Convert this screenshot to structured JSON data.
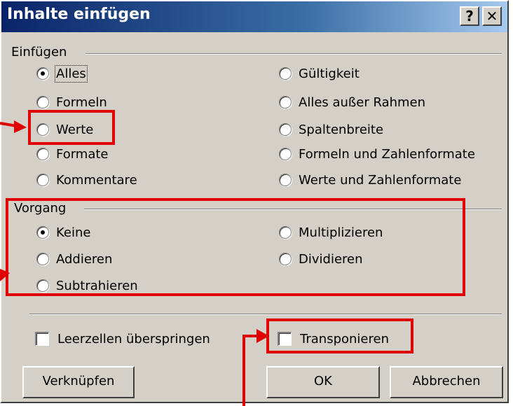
{
  "dialog": {
    "title": "Inhalte einfügen",
    "help_label": "?",
    "close_label": "✕"
  },
  "paste": {
    "legend": "Einfügen",
    "left_options": [
      {
        "label": "Alles",
        "checked": true
      },
      {
        "label": "Formeln",
        "checked": false
      },
      {
        "label": "Werte",
        "checked": false
      },
      {
        "label": "Formate",
        "checked": false
      },
      {
        "label": "Kommentare",
        "checked": false
      }
    ],
    "right_options": [
      {
        "label": "Gültigkeit",
        "checked": false
      },
      {
        "label": "Alles außer Rahmen",
        "checked": false
      },
      {
        "label": "Spaltenbreite",
        "checked": false
      },
      {
        "label": "Formeln und Zahlenformate",
        "checked": false
      },
      {
        "label": "Werte und Zahlenformate",
        "checked": false
      }
    ]
  },
  "operation": {
    "legend": "Vorgang",
    "left_options": [
      {
        "label": "Keine",
        "checked": true
      },
      {
        "label": "Addieren",
        "checked": false
      },
      {
        "label": "Subtrahieren",
        "checked": false
      }
    ],
    "right_options": [
      {
        "label": "Multiplizieren",
        "checked": false
      },
      {
        "label": "Dividieren",
        "checked": false
      }
    ]
  },
  "checkboxes": {
    "skip_blanks": {
      "label": "Leerzellen überspringen",
      "checked": false
    },
    "transpose": {
      "label": "Transponieren",
      "checked": false
    }
  },
  "buttons": {
    "link": "Verknüpfen",
    "ok": "OK",
    "cancel": "Abbrechen"
  },
  "colors": {
    "annotation": "#e00000",
    "title_bar": "#0a246a",
    "dialog_bg": "#d4d0c8"
  }
}
